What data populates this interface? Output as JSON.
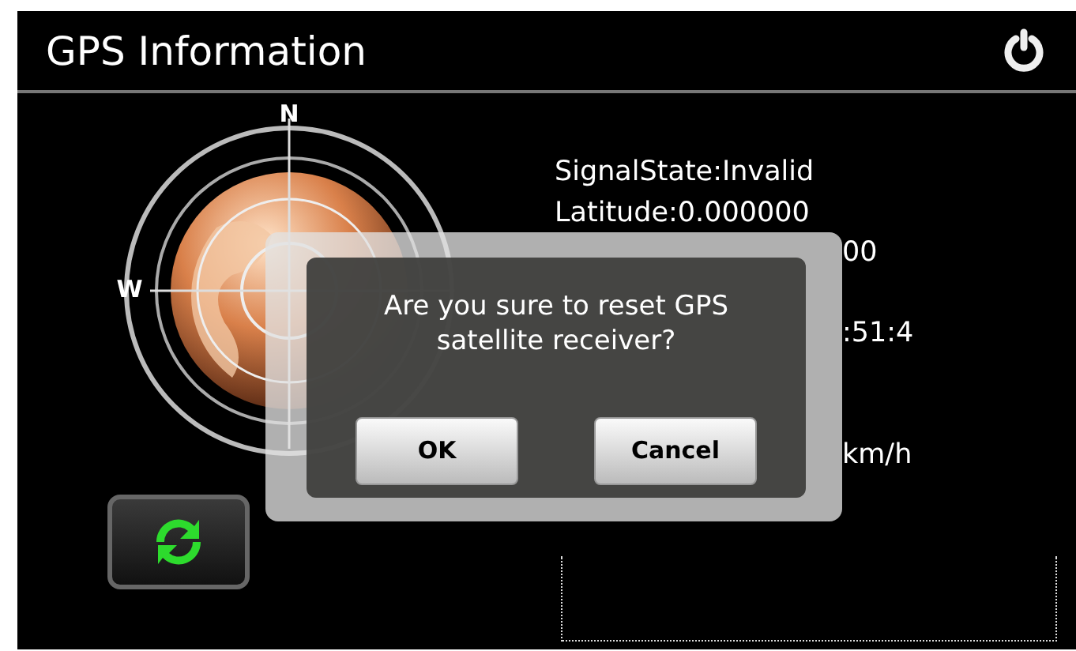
{
  "header": {
    "title": "GPS Information"
  },
  "compass": {
    "labels": [
      "N",
      "W"
    ]
  },
  "info": [
    "SignalState:Invalid",
    "Latitude:0.000000"
  ],
  "info_tails": [
    "00",
    ":51:4",
    "km/h"
  ],
  "dialog": {
    "message": "Are you sure to reset GPS satellite receiver?",
    "buttons": [
      "OK",
      "Cancel"
    ]
  }
}
